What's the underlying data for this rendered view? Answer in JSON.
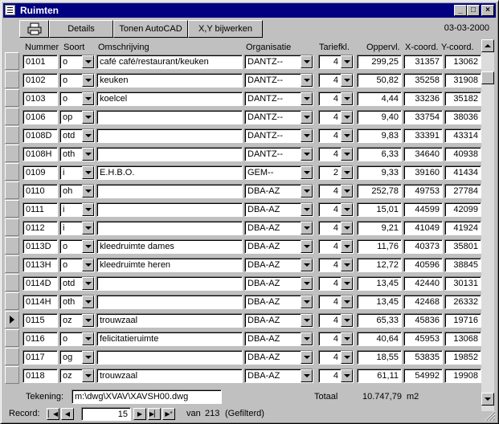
{
  "window": {
    "title": "Ruimten",
    "min": "_",
    "max": "□",
    "close": "×"
  },
  "toolbar": {
    "print_icon": "printer-icon",
    "details": "Details",
    "autocad": "Tonen AutoCAD",
    "xy": "X,Y bijwerken",
    "date": "03-03-2000"
  },
  "columns": {
    "nummer": "Nummer",
    "soort": "Soort",
    "omschrijving": "Omschrijving",
    "organisatie": "Organisatie",
    "tariefkl": "Tariefkl.",
    "oppervl": "Oppervl.",
    "xcoord": "X-coord.",
    "ycoord": "Y-coord."
  },
  "rows": [
    {
      "nummer": "0101",
      "soort": "o",
      "omschrijving": "café café/restaurant/keuken",
      "organisatie": "DANTZ--",
      "tariefkl": "4",
      "oppervl": "299,25",
      "x": "31357",
      "y": "13062"
    },
    {
      "nummer": "0102",
      "soort": "o",
      "omschrijving": "keuken",
      "organisatie": "DANTZ--",
      "tariefkl": "4",
      "oppervl": "50,82",
      "x": "35258",
      "y": "31908"
    },
    {
      "nummer": "0103",
      "soort": "o",
      "omschrijving": "koelcel",
      "organisatie": "DANTZ--",
      "tariefkl": "4",
      "oppervl": "4,44",
      "x": "33236",
      "y": "35182"
    },
    {
      "nummer": "0106",
      "soort": "op",
      "omschrijving": "",
      "organisatie": "DANTZ--",
      "tariefkl": "4",
      "oppervl": "9,40",
      "x": "33754",
      "y": "38036"
    },
    {
      "nummer": "0108D",
      "soort": "otd",
      "omschrijving": "",
      "organisatie": "DANTZ--",
      "tariefkl": "4",
      "oppervl": "9,83",
      "x": "33391",
      "y": "43314"
    },
    {
      "nummer": "0108H",
      "soort": "oth",
      "omschrijving": "",
      "organisatie": "DANTZ--",
      "tariefkl": "4",
      "oppervl": "6,33",
      "x": "34640",
      "y": "40938"
    },
    {
      "nummer": "0109",
      "soort": "i",
      "omschrijving": "E.H.B.O.",
      "organisatie": "GEM--",
      "tariefkl": "2",
      "oppervl": "9,33",
      "x": "39160",
      "y": "41434"
    },
    {
      "nummer": "0110",
      "soort": "oh",
      "omschrijving": "",
      "organisatie": "DBA-AZ",
      "tariefkl": "4",
      "oppervl": "252,78",
      "x": "49753",
      "y": "27784"
    },
    {
      "nummer": "0111",
      "soort": "i",
      "omschrijving": "",
      "organisatie": "DBA-AZ",
      "tariefkl": "4",
      "oppervl": "15,01",
      "x": "44599",
      "y": "42099"
    },
    {
      "nummer": "0112",
      "soort": "i",
      "omschrijving": "",
      "organisatie": "DBA-AZ",
      "tariefkl": "4",
      "oppervl": "9,21",
      "x": "41049",
      "y": "41924"
    },
    {
      "nummer": "0113D",
      "soort": "o",
      "omschrijving": "kleedruimte dames",
      "organisatie": "DBA-AZ",
      "tariefkl": "4",
      "oppervl": "11,76",
      "x": "40373",
      "y": "35801"
    },
    {
      "nummer": "0113H",
      "soort": "o",
      "omschrijving": "kleedruimte heren",
      "organisatie": "DBA-AZ",
      "tariefkl": "4",
      "oppervl": "12,72",
      "x": "40596",
      "y": "38845"
    },
    {
      "nummer": "0114D",
      "soort": "otd",
      "omschrijving": "",
      "organisatie": "DBA-AZ",
      "tariefkl": "4",
      "oppervl": "13,45",
      "x": "42440",
      "y": "30131"
    },
    {
      "nummer": "0114H",
      "soort": "oth",
      "omschrijving": "",
      "organisatie": "DBA-AZ",
      "tariefkl": "4",
      "oppervl": "13,45",
      "x": "42468",
      "y": "26332"
    },
    {
      "nummer": "0115",
      "soort": "oz",
      "omschrijving": "trouwzaal",
      "organisatie": "DBA-AZ",
      "tariefkl": "4",
      "oppervl": "65,33",
      "x": "45836",
      "y": "19716"
    },
    {
      "nummer": "0116",
      "soort": "o",
      "omschrijving": "felicitatieruimte",
      "organisatie": "DBA-AZ",
      "tariefkl": "4",
      "oppervl": "40,64",
      "x": "45953",
      "y": "13068"
    },
    {
      "nummer": "0117",
      "soort": "og",
      "omschrijving": "",
      "organisatie": "DBA-AZ",
      "tariefkl": "4",
      "oppervl": "18,55",
      "x": "53835",
      "y": "19852"
    },
    {
      "nummer": "0118",
      "soort": "oz",
      "omschrijving": "trouwzaal",
      "organisatie": "DBA-AZ",
      "tariefkl": "4",
      "oppervl": "61,11",
      "x": "54992",
      "y": "19908"
    }
  ],
  "current_row_index": 14,
  "footer": {
    "tekening_label": "Tekening:",
    "tekening_value": "m:\\dwg\\XVAV\\XAVSH00.dwg",
    "totaal_label": "Totaal",
    "totaal_value": "10.747,79",
    "totaal_unit": "m2"
  },
  "nav": {
    "record_label": "Record:",
    "current": "15",
    "van_label": "van",
    "total": "213",
    "filter": "(Gefilterd)"
  }
}
